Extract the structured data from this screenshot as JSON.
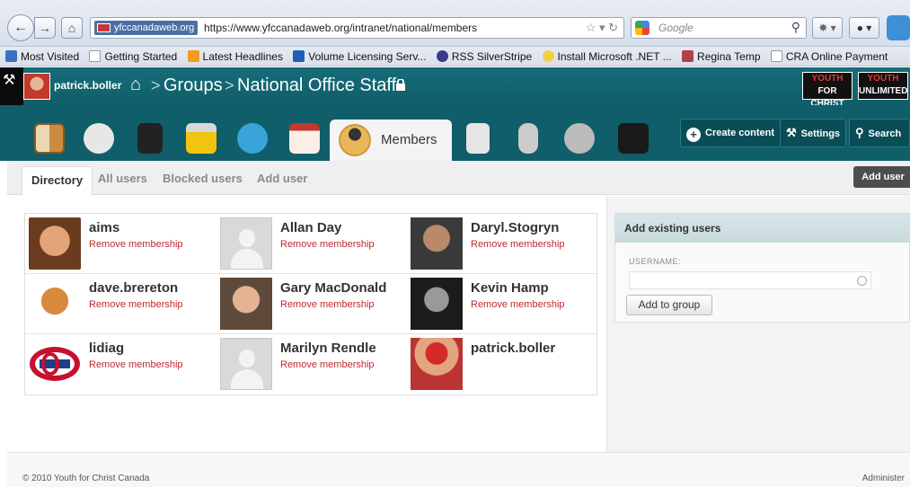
{
  "browser": {
    "site_badge": "yfccanadaweb.org",
    "url": "https://www.yfccanadaweb.org/intranet/national/members",
    "search_placeholder": "Google",
    "bookmarks": [
      "Most Visited",
      "Getting Started",
      "Latest Headlines",
      "Volume Licensing Serv...",
      "RSS SilverStripe",
      "Install Microsoft .NET ...",
      "Regina Temp",
      "CRA Online Payment"
    ]
  },
  "header": {
    "user": "patrick.boller",
    "breadcrumb": {
      "groups": "Groups",
      "separator": ">",
      "current": "National Office Staff"
    },
    "logos": {
      "yfc": {
        "line1": "YOUTH",
        "line2": "FOR CHRIST"
      },
      "yu": {
        "line1": "YOUTH",
        "line2": "UNLIMITED"
      }
    }
  },
  "toolbar": {
    "members_label": "Members",
    "create_content": "Create content",
    "settings": "Settings",
    "search": "Search"
  },
  "subtabs": {
    "directory": "Directory",
    "all_users": "All users",
    "blocked_users": "Blocked users",
    "add_user": "Add user",
    "add_user_button": "Add user"
  },
  "members": [
    {
      "name": "aims",
      "link": "Remove membership"
    },
    {
      "name": "Allan Day",
      "link": "Remove membership"
    },
    {
      "name": "Daryl.Stogryn",
      "link": "Remove membership"
    },
    {
      "name": "dave.brereton",
      "link": "Remove membership"
    },
    {
      "name": "Gary MacDonald",
      "link": "Remove membership"
    },
    {
      "name": "Kevin Hamp",
      "link": "Remove membership"
    },
    {
      "name": "lidiag",
      "link": "Remove membership"
    },
    {
      "name": "Marilyn Rendle",
      "link": "Remove membership"
    },
    {
      "name": "patrick.boller",
      "link": ""
    }
  ],
  "add_existing": {
    "title": "Add existing users",
    "username_label": "USERNAME:",
    "button": "Add to group"
  },
  "footer": {
    "copyright": "© 2010 Youth for Christ Canada",
    "administer": "Administer"
  },
  "colors": {
    "teal_header": "#176d79",
    "teal_toolbar": "#0f5e69",
    "link_red": "#c0282f"
  }
}
